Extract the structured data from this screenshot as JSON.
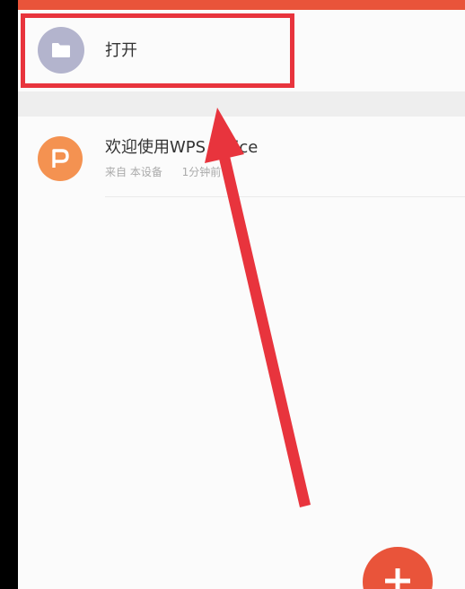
{
  "colors": {
    "accent": "#e9543a",
    "folder": "#b3b4cd",
    "file_avatar": "#f49251",
    "annotation": "#e8343d"
  },
  "open_item": {
    "icon": "folder-icon",
    "label": "打开"
  },
  "recent_files": [
    {
      "icon": "wps-p-icon",
      "title": "欢迎使用WPS Office",
      "source": "来自 本设备",
      "time": "1分钟前"
    }
  ],
  "fab": {
    "icon": "plus-icon"
  }
}
